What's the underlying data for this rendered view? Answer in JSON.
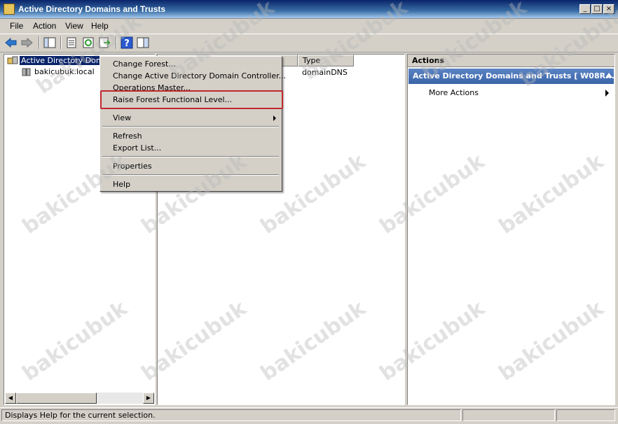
{
  "window": {
    "title": "Active Directory Domains and Trusts",
    "min_glyph": "_",
    "max_glyph": "□",
    "close_glyph": "×"
  },
  "menubar": [
    "File",
    "Action",
    "View",
    "Help"
  ],
  "tree": {
    "root_label": "Active Directory Domain",
    "child_label": "bakicubuk.local"
  },
  "list": {
    "columns": [
      "",
      "Type"
    ],
    "rows": [
      {
        "name": "",
        "type": "domainDNS"
      }
    ]
  },
  "actions": {
    "header": "Actions",
    "section_title": "Active Directory Domains and Trusts [ W08R...",
    "more_actions": "More Actions"
  },
  "context_menu": {
    "items": [
      "Change Forest...",
      "Change Active Directory Domain Controller...",
      "Operations Master...",
      "Raise Forest Functional Level...",
      "View",
      "Refresh",
      "Export List...",
      "Properties",
      "Help"
    ]
  },
  "statusbar": {
    "text": "Displays Help for the current selection."
  },
  "watermark": "bakicubuk",
  "colors": {
    "selection": "#0a246a",
    "highlight_box": "#c0282d",
    "action_section": "#3a64a8"
  },
  "icons": {
    "app": "ad-trusts-icon",
    "back": "back-arrow-icon",
    "forward": "forward-arrow-icon",
    "help": "help-icon"
  }
}
